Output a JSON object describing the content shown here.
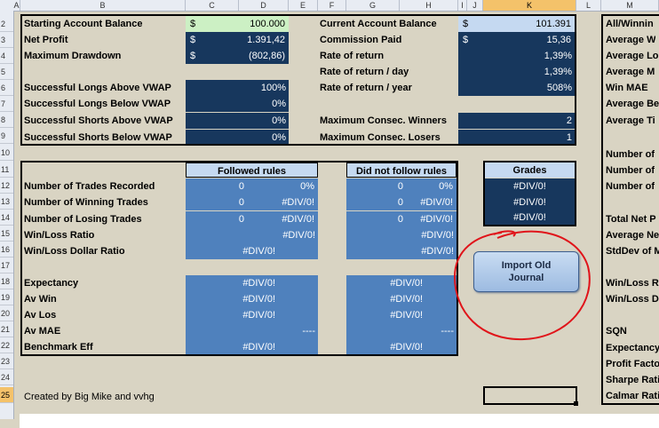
{
  "col_headers": [
    "A",
    "B",
    "C",
    "D",
    "E",
    "F",
    "G",
    "H",
    "I",
    "J",
    "K",
    "L",
    "M"
  ],
  "row_headers": [
    "2",
    "3",
    "4",
    "5",
    "6",
    "7",
    "8",
    "9",
    "10",
    "11",
    "12",
    "13",
    "14",
    "15",
    "16",
    "17",
    "18",
    "19",
    "20",
    "21",
    "22",
    "23",
    "24",
    "25"
  ],
  "top_left": {
    "starting_balance_label": "Starting Account Balance",
    "starting_balance_currency": "$",
    "starting_balance_value": "100.000",
    "net_profit_label": "Net Profit",
    "net_profit_currency": "$",
    "net_profit_value": "1.391,42",
    "max_drawdown_label": "Maximum Drawdown",
    "max_drawdown_currency": "$",
    "max_drawdown_value": "(802,86)",
    "longs_above_label": "Successful Longs Above VWAP",
    "longs_above_value": "100%",
    "longs_below_label": "Successful Longs Below VWAP",
    "longs_below_value": "0%",
    "shorts_above_label": "Successful Shorts Above VWAP",
    "shorts_above_value": "0%",
    "shorts_below_label": "Successful Shorts Below VWAP",
    "shorts_below_value": "0%"
  },
  "top_right": {
    "current_balance_label": "Current Account Balance",
    "current_balance_currency": "$",
    "current_balance_value": "101.391",
    "commission_label": "Commission Paid",
    "commission_currency": "$",
    "commission_value": "15,36",
    "ror_label": "Rate of return",
    "ror_value": "1,39%",
    "ror_day_label": "Rate of return / day",
    "ror_day_value": "1,39%",
    "ror_year_label": "Rate of return / year",
    "ror_year_value": "508%",
    "consec_winners_label": "Maximum Consec. Winners",
    "consec_winners_value": "2",
    "consec_losers_label": "Maximum Consec. Losers",
    "consec_losers_value": "1"
  },
  "far_right_labels": [
    "All/Winnin",
    "Average W",
    "Average Lo",
    "Average M",
    "Win MAE",
    "Average Be",
    "Average Ti",
    "",
    "Number of",
    "Number of",
    "Number of",
    "",
    "Total Net P",
    "Average Ne",
    "StdDev of M",
    "",
    "Win/Loss R",
    "Win/Loss D",
    "",
    "SQN",
    "Expectancy",
    "Profit Facto",
    "Sharpe Rati",
    "Calmar Rati"
  ],
  "rules": {
    "followed_header": "Followed rules",
    "not_followed_header": "Did not follow rules",
    "grades_header": "Grades",
    "rows": [
      {
        "label": "Number of Trades Recorded",
        "f1": "0",
        "f2": "0%",
        "n1": "0",
        "n2": "0%",
        "grade": "#DIV/0!"
      },
      {
        "label": "Number of Winning Trades",
        "f1": "0",
        "f2": "#DIV/0!",
        "n1": "0",
        "n2": "#DIV/0!",
        "grade": "#DIV/0!"
      },
      {
        "label": "Number of Losing Trades",
        "f1": "0",
        "f2": "#DIV/0!",
        "n1": "0",
        "n2": "#DIV/0!",
        "grade": "#DIV/0!"
      },
      {
        "label": "Win/Loss Ratio",
        "f1": "",
        "f2": "#DIV/0!",
        "n1": "",
        "n2": "#DIV/0!",
        "grade": ""
      },
      {
        "label": "Win/Loss Dollar Ratio",
        "f1": "#DIV/0!",
        "f2": "",
        "n1": "",
        "n2": "#DIV/0!",
        "grade": ""
      }
    ],
    "rows2": [
      {
        "label": "Expectancy",
        "f1": "#DIV/0!",
        "f2": "",
        "n1": "#DIV/0!",
        "n2": ""
      },
      {
        "label": "Av Win",
        "f1": "#DIV/0!",
        "f2": "",
        "n1": "#DIV/0!",
        "n2": ""
      },
      {
        "label": "Av Los",
        "f1": "#DIV/0!",
        "f2": "",
        "n1": "#DIV/0!",
        "n2": ""
      },
      {
        "label": "Av MAE",
        "f1": "",
        "f2": "----",
        "n1": "",
        "n2": "----"
      },
      {
        "label": "Benchmark Eff",
        "f1": "#DIV/0!",
        "f2": "",
        "n1": "#DIV/0!",
        "n2": ""
      }
    ]
  },
  "import_button_label": "Import Old Journal",
  "credit_text": "Created by Big Mike and vvhg",
  "colors": {
    "dark": "#17375d",
    "medium": "#4f81bd",
    "light": "#c5d9f1",
    "annotation": "#e0141a"
  }
}
